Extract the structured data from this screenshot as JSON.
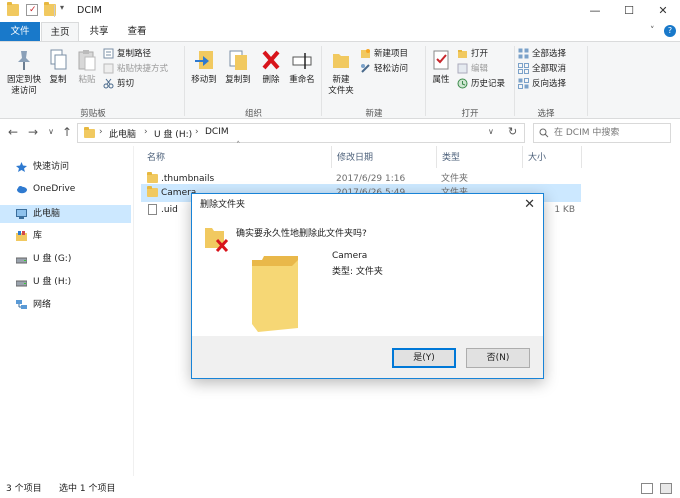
{
  "window": {
    "title": "DCIM",
    "minimize_glyph": "—",
    "maximize_glyph": "☐",
    "close_glyph": "✕",
    "help_glyph": "?",
    "expand_glyph": "˅"
  },
  "ribbon_tabs": [
    "文件",
    "主页",
    "共享",
    "查看"
  ],
  "ribbon": {
    "clipboard": {
      "pin_label_1": "固定到快",
      "pin_label_2": "速访问",
      "copy": "复制",
      "paste": "粘贴",
      "copy_path": "复制路径",
      "paste_shortcut": "粘贴快捷方式",
      "cut": "剪切",
      "group": "剪贴板"
    },
    "organize": {
      "move_to": "移动到",
      "copy_to": "复制到",
      "delete": "删除",
      "rename": "重命名",
      "group": "组织"
    },
    "new": {
      "new_folder_1": "新建",
      "new_folder_2": "文件夹",
      "new_item": "新建项目",
      "easy_access": "轻松访问",
      "group": "新建"
    },
    "open": {
      "properties": "属性",
      "open": "打开",
      "edit": "编辑",
      "history": "历史记录",
      "group": "打开"
    },
    "select": {
      "select_all": "全部选择",
      "select_none": "全部取消",
      "invert": "反向选择",
      "group": "选择"
    }
  },
  "address": {
    "back": "←",
    "forward": "→",
    "dropdown": "∨",
    "up": "↑",
    "path": [
      "此电脑",
      "U 盘 (H:)",
      "DCIM"
    ],
    "separator": "›",
    "refresh": "↻",
    "search_placeholder": "在 DCIM 中搜索"
  },
  "nav_pane": [
    {
      "label": "快速访问",
      "icon": "star-icon"
    },
    {
      "label": "OneDrive",
      "icon": "cloud-icon"
    },
    {
      "label": "此电脑",
      "icon": "computer-icon"
    },
    {
      "label": "库",
      "icon": "library-icon"
    },
    {
      "label": "U 盘 (G:)",
      "icon": "usb-drive-icon"
    },
    {
      "label": "U 盘 (H:)",
      "icon": "usb-drive-icon"
    },
    {
      "label": "网络",
      "icon": "network-icon"
    }
  ],
  "columns": [
    "名称",
    "修改日期",
    "类型",
    "大小"
  ],
  "files": [
    {
      "name": ".thumbnails",
      "date": "2017/6/29 1:16",
      "type": "文件夹",
      "size": ""
    },
    {
      "name": "Camera",
      "date": "2017/6/26 5:49",
      "type": "文件夹",
      "size": ""
    },
    {
      "name": ".uid",
      "date": "",
      "type": "",
      "size": "1 KB"
    }
  ],
  "status": {
    "count": "3 个项目",
    "selected": "选中 1 个项目"
  },
  "dialog": {
    "title": "删除文件夹",
    "message": "确实要永久性地删除此文件夹吗?",
    "item_name": "Camera",
    "item_type": "类型: 文件夹",
    "yes_button": "是(Y)",
    "no_button": "否(N)"
  }
}
